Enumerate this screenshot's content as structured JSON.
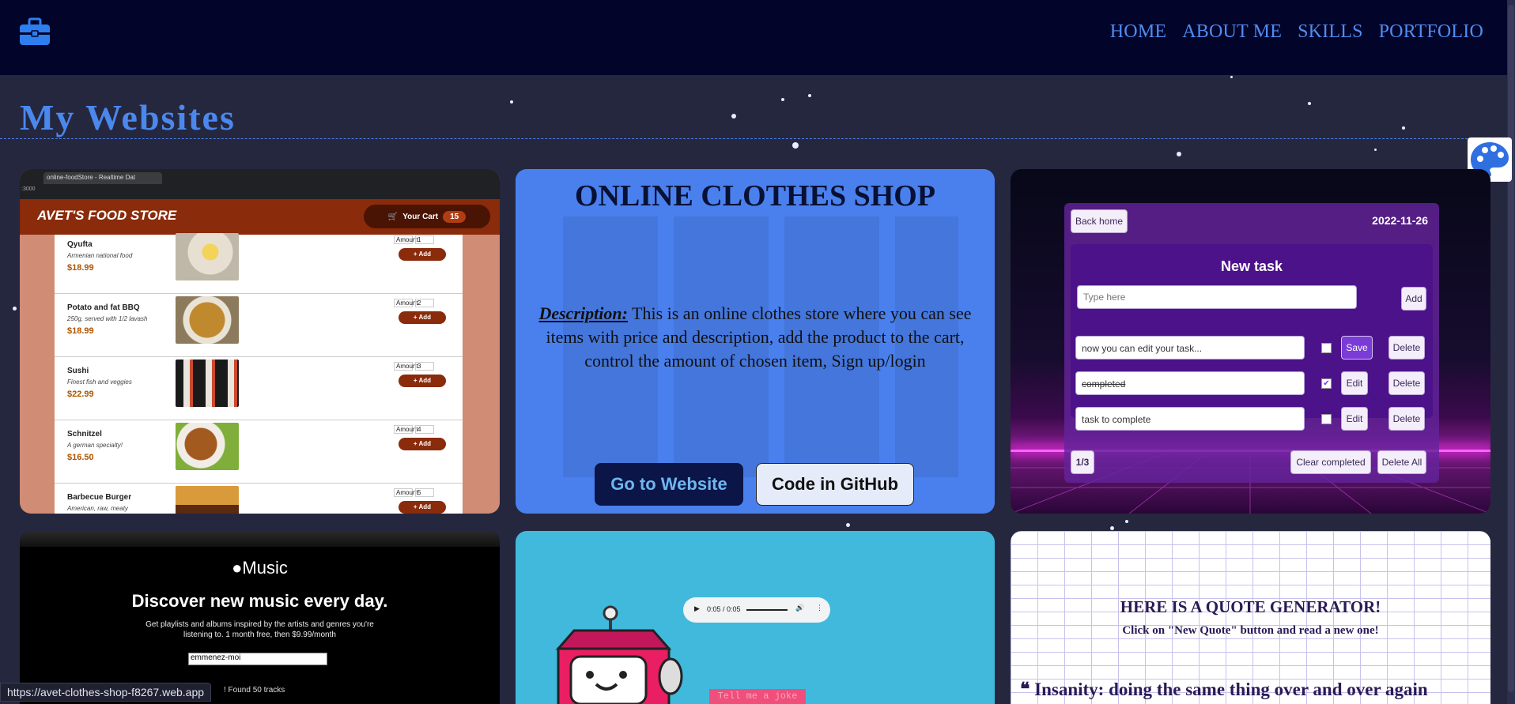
{
  "nav": {
    "items": [
      "HOME",
      "ABOUT ME",
      "SKILLS",
      "PORTFOLIO"
    ]
  },
  "page": {
    "title": "My Websites"
  },
  "status_url": "https://avet-clothes-shop-f8267.web.app",
  "food_card": {
    "tab_title": "online-foodStore - Realtime Dat",
    "url": ":3000",
    "brand": "AVET'S FOOD STORE",
    "cart_label": "Your Cart",
    "cart_count": "15",
    "amount_label": "Amount",
    "add_label": "+ Add",
    "items": [
      {
        "name": "Qyufta",
        "desc": "Armenian national food",
        "price": "$18.99",
        "amount": "1"
      },
      {
        "name": "Potato and fat BBQ",
        "desc": "250g, served with 1/2 lavash",
        "price": "$18.99",
        "amount": "2"
      },
      {
        "name": "Sushi",
        "desc": "Finest fish and veggies",
        "price": "$22.99",
        "amount": "3"
      },
      {
        "name": "Schnitzel",
        "desc": "A german specialty!",
        "price": "$16.50",
        "amount": "4"
      },
      {
        "name": "Barbecue Burger",
        "desc": "American, raw, meaty",
        "price": "",
        "amount": "5"
      }
    ]
  },
  "clothes_card": {
    "title": "ONLINE CLOTHES SHOP",
    "desc_label": "Description:",
    "desc_text": " This is an online clothes store where you can see items with price and description, add the product to the cart, control the amount of chosen item, Sign up/login",
    "website_button": "Go to Website",
    "github_button": "Code in GitHub"
  },
  "todo_card": {
    "back_button": "Back home",
    "date": "2022-11-26",
    "new_task_title": "New task",
    "input_placeholder": "Type here",
    "add_button": "Add",
    "tasks": [
      {
        "text": "now you can edit your task...",
        "checked": false,
        "edit_label": "Save"
      },
      {
        "text": "completed",
        "checked": true,
        "edit_label": "Edit"
      },
      {
        "text": "task to complete",
        "checked": false,
        "edit_label": "Edit"
      }
    ],
    "delete_label": "Delete",
    "counter": "1/3",
    "clear_completed": "Clear completed",
    "delete_all": "Delete All"
  },
  "music_card": {
    "logo_text": "Music",
    "headline": "Discover new music every day.",
    "subline": "Get playlists and albums inspired by the artists and genres you're listening to. 1 month free, then $9.99/month",
    "search_value": "emmenez-moi",
    "found_text": "! Found 50 tracks"
  },
  "robot_card": {
    "audio_time": "0:05 / 0:05",
    "joke_button": "Tell me a joke"
  },
  "quote_card": {
    "title": "HERE IS A QUOTE GENERATOR!",
    "subtitle": "Click on \"New Quote\" button and read a new one!",
    "quote": "Insanity: doing the same thing over and over again"
  },
  "colors": {
    "header_bg": "#03042a",
    "page_bg": "#25273f",
    "accent_blue": "#4a88ee",
    "nav_link": "#4f8cf0"
  }
}
